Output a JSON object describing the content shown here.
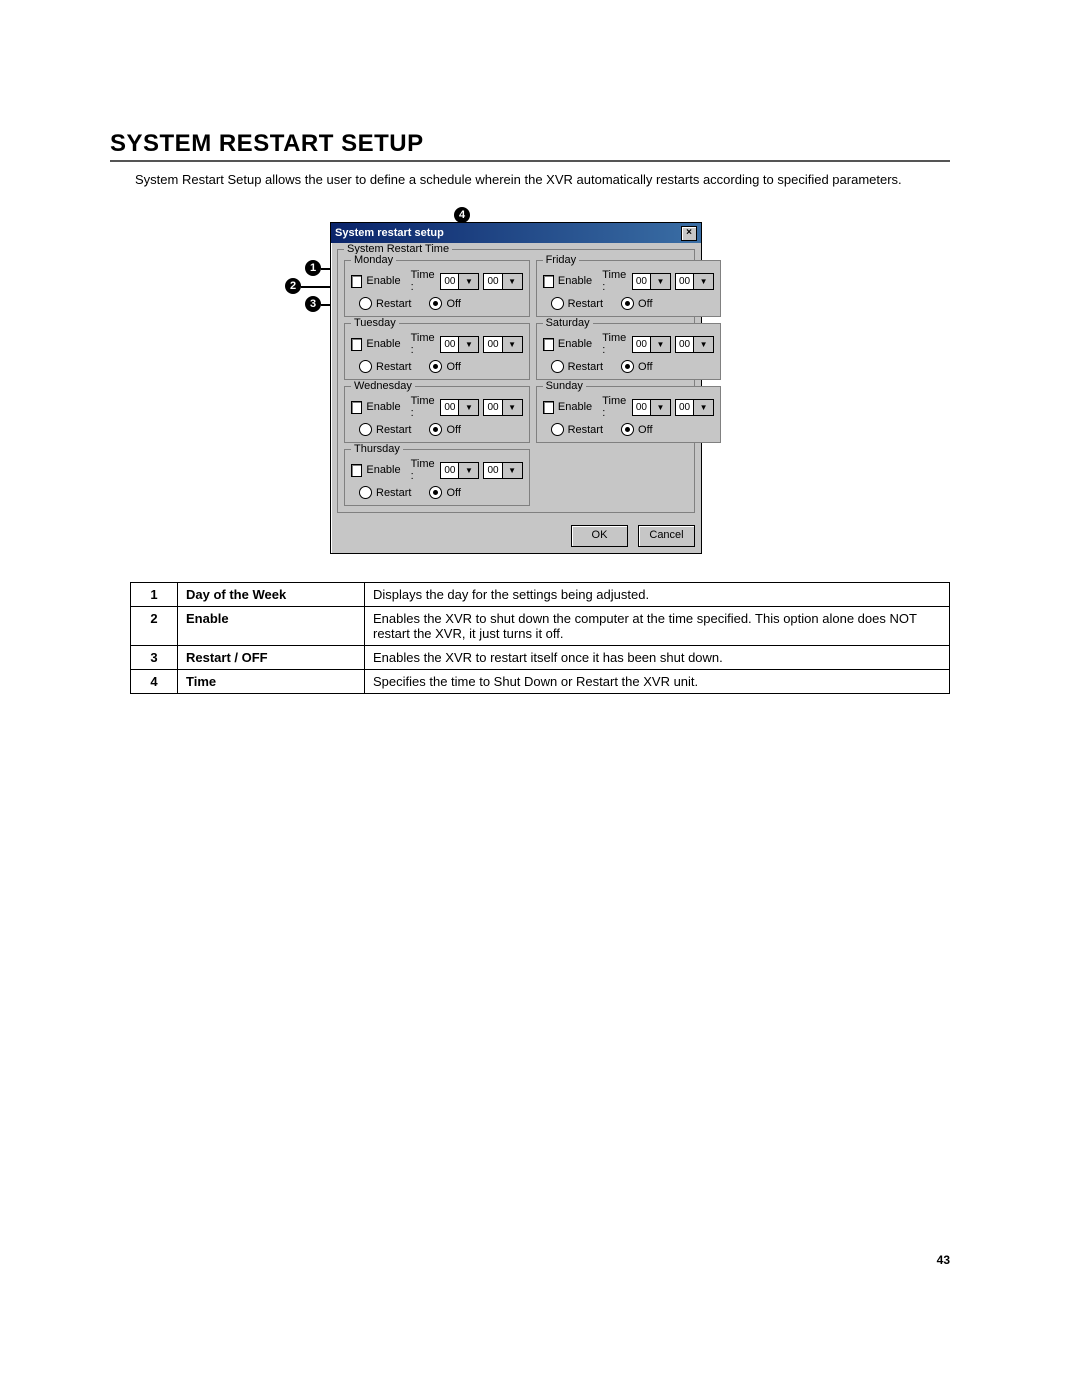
{
  "page": {
    "title": "SYSTEM RESTART SETUP",
    "intro": "System Restart Setup allows the user to define a schedule wherein the XVR automatically restarts according to specified parameters.",
    "number": "43"
  },
  "dialog": {
    "title": "System restart setup",
    "group_label": "System Restart Time",
    "enable_label": "Enable",
    "time_label": "Time :",
    "restart_label": "Restart",
    "off_label": "Off",
    "ok": "OK",
    "cancel": "Cancel",
    "hour_value": "00",
    "min_value": "00",
    "days": [
      {
        "name": "Monday"
      },
      {
        "name": "Friday"
      },
      {
        "name": "Tuesday"
      },
      {
        "name": "Saturday"
      },
      {
        "name": "Wednesday"
      },
      {
        "name": "Sunday"
      },
      {
        "name": "Thursday"
      }
    ]
  },
  "callouts": {
    "c1": "1",
    "c2": "2",
    "c3": "3",
    "c4": "4"
  },
  "table": {
    "rows": [
      {
        "n": "1",
        "name": "Day of the Week",
        "desc": "Displays the day for the settings being adjusted."
      },
      {
        "n": "2",
        "name": "Enable",
        "desc": "Enables the XVR to shut down the computer at the time specified. This option alone does NOT restart the XVR, it just turns it off."
      },
      {
        "n": "3",
        "name": "Restart / OFF",
        "desc": "Enables the XVR to restart itself once it has been shut down."
      },
      {
        "n": "4",
        "name": "Time",
        "desc": "Specifies the time to Shut Down or Restart the XVR unit."
      }
    ]
  }
}
